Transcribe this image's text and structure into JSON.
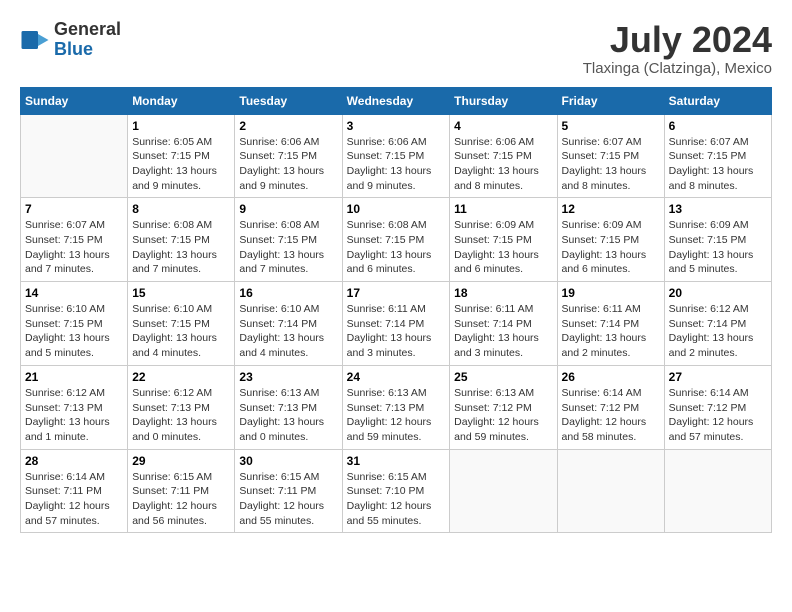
{
  "header": {
    "logo_general": "General",
    "logo_blue": "Blue",
    "month_year": "July 2024",
    "location": "Tlaxinga (Clatzinga), Mexico"
  },
  "weekdays": [
    "Sunday",
    "Monday",
    "Tuesday",
    "Wednesday",
    "Thursday",
    "Friday",
    "Saturday"
  ],
  "weeks": [
    [
      {
        "day": "",
        "info": ""
      },
      {
        "day": "1",
        "info": "Sunrise: 6:05 AM\nSunset: 7:15 PM\nDaylight: 13 hours and 9 minutes."
      },
      {
        "day": "2",
        "info": "Sunrise: 6:06 AM\nSunset: 7:15 PM\nDaylight: 13 hours and 9 minutes."
      },
      {
        "day": "3",
        "info": "Sunrise: 6:06 AM\nSunset: 7:15 PM\nDaylight: 13 hours and 9 minutes."
      },
      {
        "day": "4",
        "info": "Sunrise: 6:06 AM\nSunset: 7:15 PM\nDaylight: 13 hours and 8 minutes."
      },
      {
        "day": "5",
        "info": "Sunrise: 6:07 AM\nSunset: 7:15 PM\nDaylight: 13 hours and 8 minutes."
      },
      {
        "day": "6",
        "info": "Sunrise: 6:07 AM\nSunset: 7:15 PM\nDaylight: 13 hours and 8 minutes."
      }
    ],
    [
      {
        "day": "7",
        "info": "Sunrise: 6:07 AM\nSunset: 7:15 PM\nDaylight: 13 hours and 7 minutes."
      },
      {
        "day": "8",
        "info": "Sunrise: 6:08 AM\nSunset: 7:15 PM\nDaylight: 13 hours and 7 minutes."
      },
      {
        "day": "9",
        "info": "Sunrise: 6:08 AM\nSunset: 7:15 PM\nDaylight: 13 hours and 7 minutes."
      },
      {
        "day": "10",
        "info": "Sunrise: 6:08 AM\nSunset: 7:15 PM\nDaylight: 13 hours and 6 minutes."
      },
      {
        "day": "11",
        "info": "Sunrise: 6:09 AM\nSunset: 7:15 PM\nDaylight: 13 hours and 6 minutes."
      },
      {
        "day": "12",
        "info": "Sunrise: 6:09 AM\nSunset: 7:15 PM\nDaylight: 13 hours and 6 minutes."
      },
      {
        "day": "13",
        "info": "Sunrise: 6:09 AM\nSunset: 7:15 PM\nDaylight: 13 hours and 5 minutes."
      }
    ],
    [
      {
        "day": "14",
        "info": "Sunrise: 6:10 AM\nSunset: 7:15 PM\nDaylight: 13 hours and 5 minutes."
      },
      {
        "day": "15",
        "info": "Sunrise: 6:10 AM\nSunset: 7:15 PM\nDaylight: 13 hours and 4 minutes."
      },
      {
        "day": "16",
        "info": "Sunrise: 6:10 AM\nSunset: 7:14 PM\nDaylight: 13 hours and 4 minutes."
      },
      {
        "day": "17",
        "info": "Sunrise: 6:11 AM\nSunset: 7:14 PM\nDaylight: 13 hours and 3 minutes."
      },
      {
        "day": "18",
        "info": "Sunrise: 6:11 AM\nSunset: 7:14 PM\nDaylight: 13 hours and 3 minutes."
      },
      {
        "day": "19",
        "info": "Sunrise: 6:11 AM\nSunset: 7:14 PM\nDaylight: 13 hours and 2 minutes."
      },
      {
        "day": "20",
        "info": "Sunrise: 6:12 AM\nSunset: 7:14 PM\nDaylight: 13 hours and 2 minutes."
      }
    ],
    [
      {
        "day": "21",
        "info": "Sunrise: 6:12 AM\nSunset: 7:13 PM\nDaylight: 13 hours and 1 minute."
      },
      {
        "day": "22",
        "info": "Sunrise: 6:12 AM\nSunset: 7:13 PM\nDaylight: 13 hours and 0 minutes."
      },
      {
        "day": "23",
        "info": "Sunrise: 6:13 AM\nSunset: 7:13 PM\nDaylight: 13 hours and 0 minutes."
      },
      {
        "day": "24",
        "info": "Sunrise: 6:13 AM\nSunset: 7:13 PM\nDaylight: 12 hours and 59 minutes."
      },
      {
        "day": "25",
        "info": "Sunrise: 6:13 AM\nSunset: 7:12 PM\nDaylight: 12 hours and 59 minutes."
      },
      {
        "day": "26",
        "info": "Sunrise: 6:14 AM\nSunset: 7:12 PM\nDaylight: 12 hours and 58 minutes."
      },
      {
        "day": "27",
        "info": "Sunrise: 6:14 AM\nSunset: 7:12 PM\nDaylight: 12 hours and 57 minutes."
      }
    ],
    [
      {
        "day": "28",
        "info": "Sunrise: 6:14 AM\nSunset: 7:11 PM\nDaylight: 12 hours and 57 minutes."
      },
      {
        "day": "29",
        "info": "Sunrise: 6:15 AM\nSunset: 7:11 PM\nDaylight: 12 hours and 56 minutes."
      },
      {
        "day": "30",
        "info": "Sunrise: 6:15 AM\nSunset: 7:11 PM\nDaylight: 12 hours and 55 minutes."
      },
      {
        "day": "31",
        "info": "Sunrise: 6:15 AM\nSunset: 7:10 PM\nDaylight: 12 hours and 55 minutes."
      },
      {
        "day": "",
        "info": ""
      },
      {
        "day": "",
        "info": ""
      },
      {
        "day": "",
        "info": ""
      }
    ]
  ]
}
